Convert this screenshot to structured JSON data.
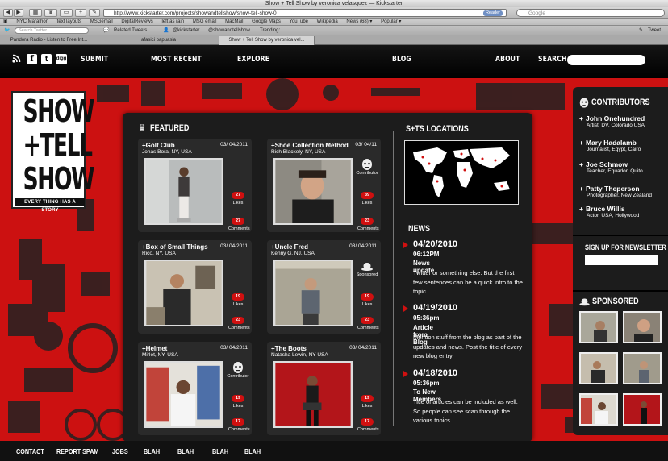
{
  "browser": {
    "window_title": "Show + Tell Show by veronica velasquez — Kickstarter",
    "url": "http://www.kickstarter.com/projects/showandtellshow/show-tell-show-0",
    "reader_label": "Reader",
    "search_placeholder": "Google",
    "bookmarks": [
      "NYC Marathon",
      "text layouts",
      "MSGemail",
      "DigitalReviews",
      "left as rain",
      "MSG email",
      "MacMail",
      "Google Maps",
      "YouTube",
      "Wikipedia",
      "News (68) ▾",
      "Popular ▾"
    ],
    "twitter_bar": {
      "search_placeholder": "Search Twitter",
      "related": "Related Tweets",
      "handle1": "@kickstarter",
      "handle2": "@showandtellshow",
      "trending": "Trending:",
      "tweet": "Tweet"
    },
    "tabs": [
      "Pandora Radio - Listen to Free Int...",
      "afasici papuasia",
      "Show + Tell Show by veronica vel..."
    ]
  },
  "nav": {
    "submit": "SUBMIT",
    "most_recent": "MOST RECENT",
    "explore": "EXPLORE",
    "blog": "BLOG",
    "about": "ABOUT",
    "search": "SEARCH",
    "social": {
      "digg": "digg"
    }
  },
  "logo": {
    "line1": "SHOW",
    "line2": "+TELL",
    "line3": "SHOW",
    "tagline": "EVERY THING HAS A STORY"
  },
  "featured": {
    "heading": "FEATURED",
    "likes_label": "Likes",
    "comments_label": "Comments",
    "contributor_label": "Contributor",
    "sponsored_label": "Sponsored",
    "cards": [
      {
        "title": "+Golf Club",
        "date": "03/ 04/2011",
        "subtitle": "Jonas Bora, NY, USA",
        "likes": "27",
        "comments": "27",
        "badge": ""
      },
      {
        "title": "+Shoe Collection Method",
        "date": "03/ 04/11",
        "subtitle": "Rich Blackely, NY, USA",
        "likes": "39",
        "comments": "23",
        "badge": "contributor"
      },
      {
        "title": "+Box of Small Things",
        "date": "03/ 04/2011",
        "subtitle": "Rico, NY, USA",
        "likes": "19",
        "comments": "23",
        "badge": ""
      },
      {
        "title": "+Uncle Fred",
        "date": "03/ 04/2011",
        "subtitle": "Kenny G, NJ, USA",
        "likes": "19",
        "comments": "23",
        "badge": "sponsored"
      },
      {
        "title": "+Helmet",
        "date": "03/ 04/2011",
        "subtitle": "Mirlet, NY, USA",
        "likes": "19",
        "comments": "17",
        "badge": "contributor"
      },
      {
        "title": "+The Boots",
        "date": "03/ 04/2011",
        "subtitle": "Natasha Lewin, NY USA",
        "likes": "19",
        "comments": "17",
        "badge": ""
      }
    ]
  },
  "locations": {
    "heading": "S+TS LOCATIONS"
  },
  "news": {
    "heading": "NEWS",
    "items": [
      {
        "date": "04/20/2010",
        "time": "06:12PM",
        "title": "News update",
        "body": "Twitter or something else. But the first few sentences can be a quick intro to the topic."
      },
      {
        "date": "04/19/2010",
        "time": "05:36pm",
        "title": "Article from Blog",
        "body": "Mention stuff from the blog as part of the updates and news. Post the title of every new blog entry"
      },
      {
        "date": "04/18/2010",
        "time": "05:36pm",
        "title": "To New Members",
        "body": "Title of articles can be included as well. So people can see scan through the various topics."
      }
    ]
  },
  "contributors": {
    "heading": "CONTRIBUTORS",
    "items": [
      {
        "name": "John Onehundred",
        "meta": "Artist, DV, Colorado USA"
      },
      {
        "name": "Mary Hadalamb",
        "meta": "Journalist, Egypt, Cairo"
      },
      {
        "name": "Joe Schmow",
        "meta": "Teacher, Equador, Quito"
      },
      {
        "name": "Patty Theperson",
        "meta": "Photographer, New Zealand"
      },
      {
        "name": "Bruce Willis",
        "meta": "Actor, USA, Hollywood"
      }
    ]
  },
  "newsletter": {
    "heading": "SIGN UP FOR NEWSLETTER"
  },
  "sponsored": {
    "heading": "SPONSORED"
  },
  "footer": {
    "links": [
      "CONTACT",
      "REPORT SPAM",
      "JOBS",
      "BLAH",
      "BLAH",
      "BLAH",
      "BLAH"
    ]
  },
  "colors": {
    "brand_red": "#cc1111",
    "panel": "#1c1c1c",
    "pill": "#d01010"
  }
}
